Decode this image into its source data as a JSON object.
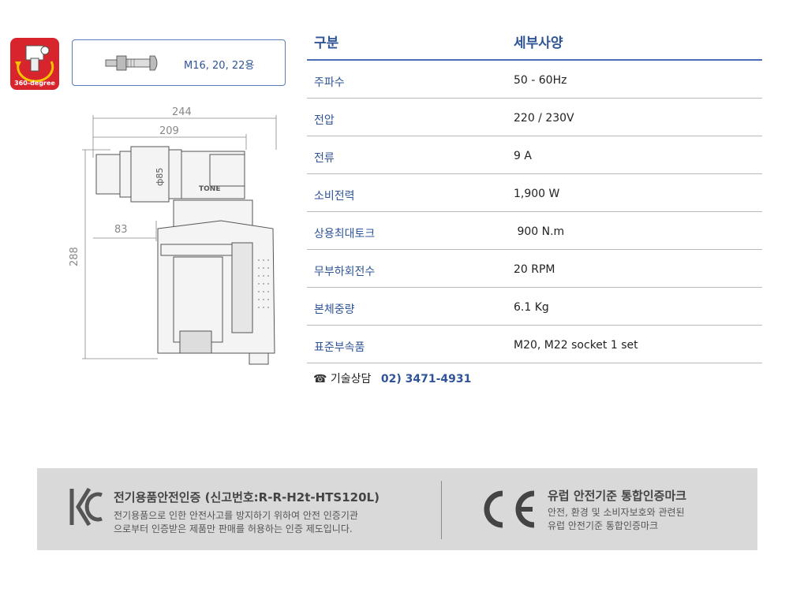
{
  "badge": {
    "caption": "360-degree"
  },
  "bolt_box": {
    "sizes": "M16, 20, 22용"
  },
  "drawing": {
    "dim_244": "244",
    "dim_209": "209",
    "dim_85": "ф85",
    "dim_83": "83",
    "dim_288": "288",
    "brand_mark": "TONE"
  },
  "spec": {
    "header_key": "구분",
    "header_value": "세부사양",
    "rows": [
      {
        "key": "주파수",
        "value": "50 - 60Hz"
      },
      {
        "key": "전압",
        "value": "220 / 230V"
      },
      {
        "key": "전류",
        "value": "9 A"
      },
      {
        "key": "소비전력",
        "value": "1,900 W"
      },
      {
        "key": "상용최대토크",
        "value": " 900 N.m"
      },
      {
        "key": "무부하회전수",
        "value": "20 RPM"
      },
      {
        "key": "본체중량",
        "value": "6.1 Kg"
      },
      {
        "key": "표준부속품",
        "value": "M20, M22 socket 1 set"
      }
    ]
  },
  "phone": {
    "icon": "phone-icon",
    "label": "기술상담",
    "number": "02) 3471-4931"
  },
  "certification": {
    "kc_title": "전기용품안전인증 (신고번호:R-R-H2t-HTS120L)",
    "kc_desc_1": "전기용품으로 인한  안전사고를 방지하기 위하여 안전 인증기관",
    "kc_desc_2": "으로부터 인증받은 제품만 판매를 허용하는 인증 제도입니다.",
    "ce_title": "유럽 안전기준 통합인증마크",
    "ce_desc_1": "안전, 환경 및 소비자보호와 관련된",
    "ce_desc_2": "유럽 안전기준 통합인증마크"
  },
  "colors": {
    "accent_blue": "#2f5597",
    "badge_red": "#d8252d",
    "footer_gray": "#d9d9d9"
  }
}
